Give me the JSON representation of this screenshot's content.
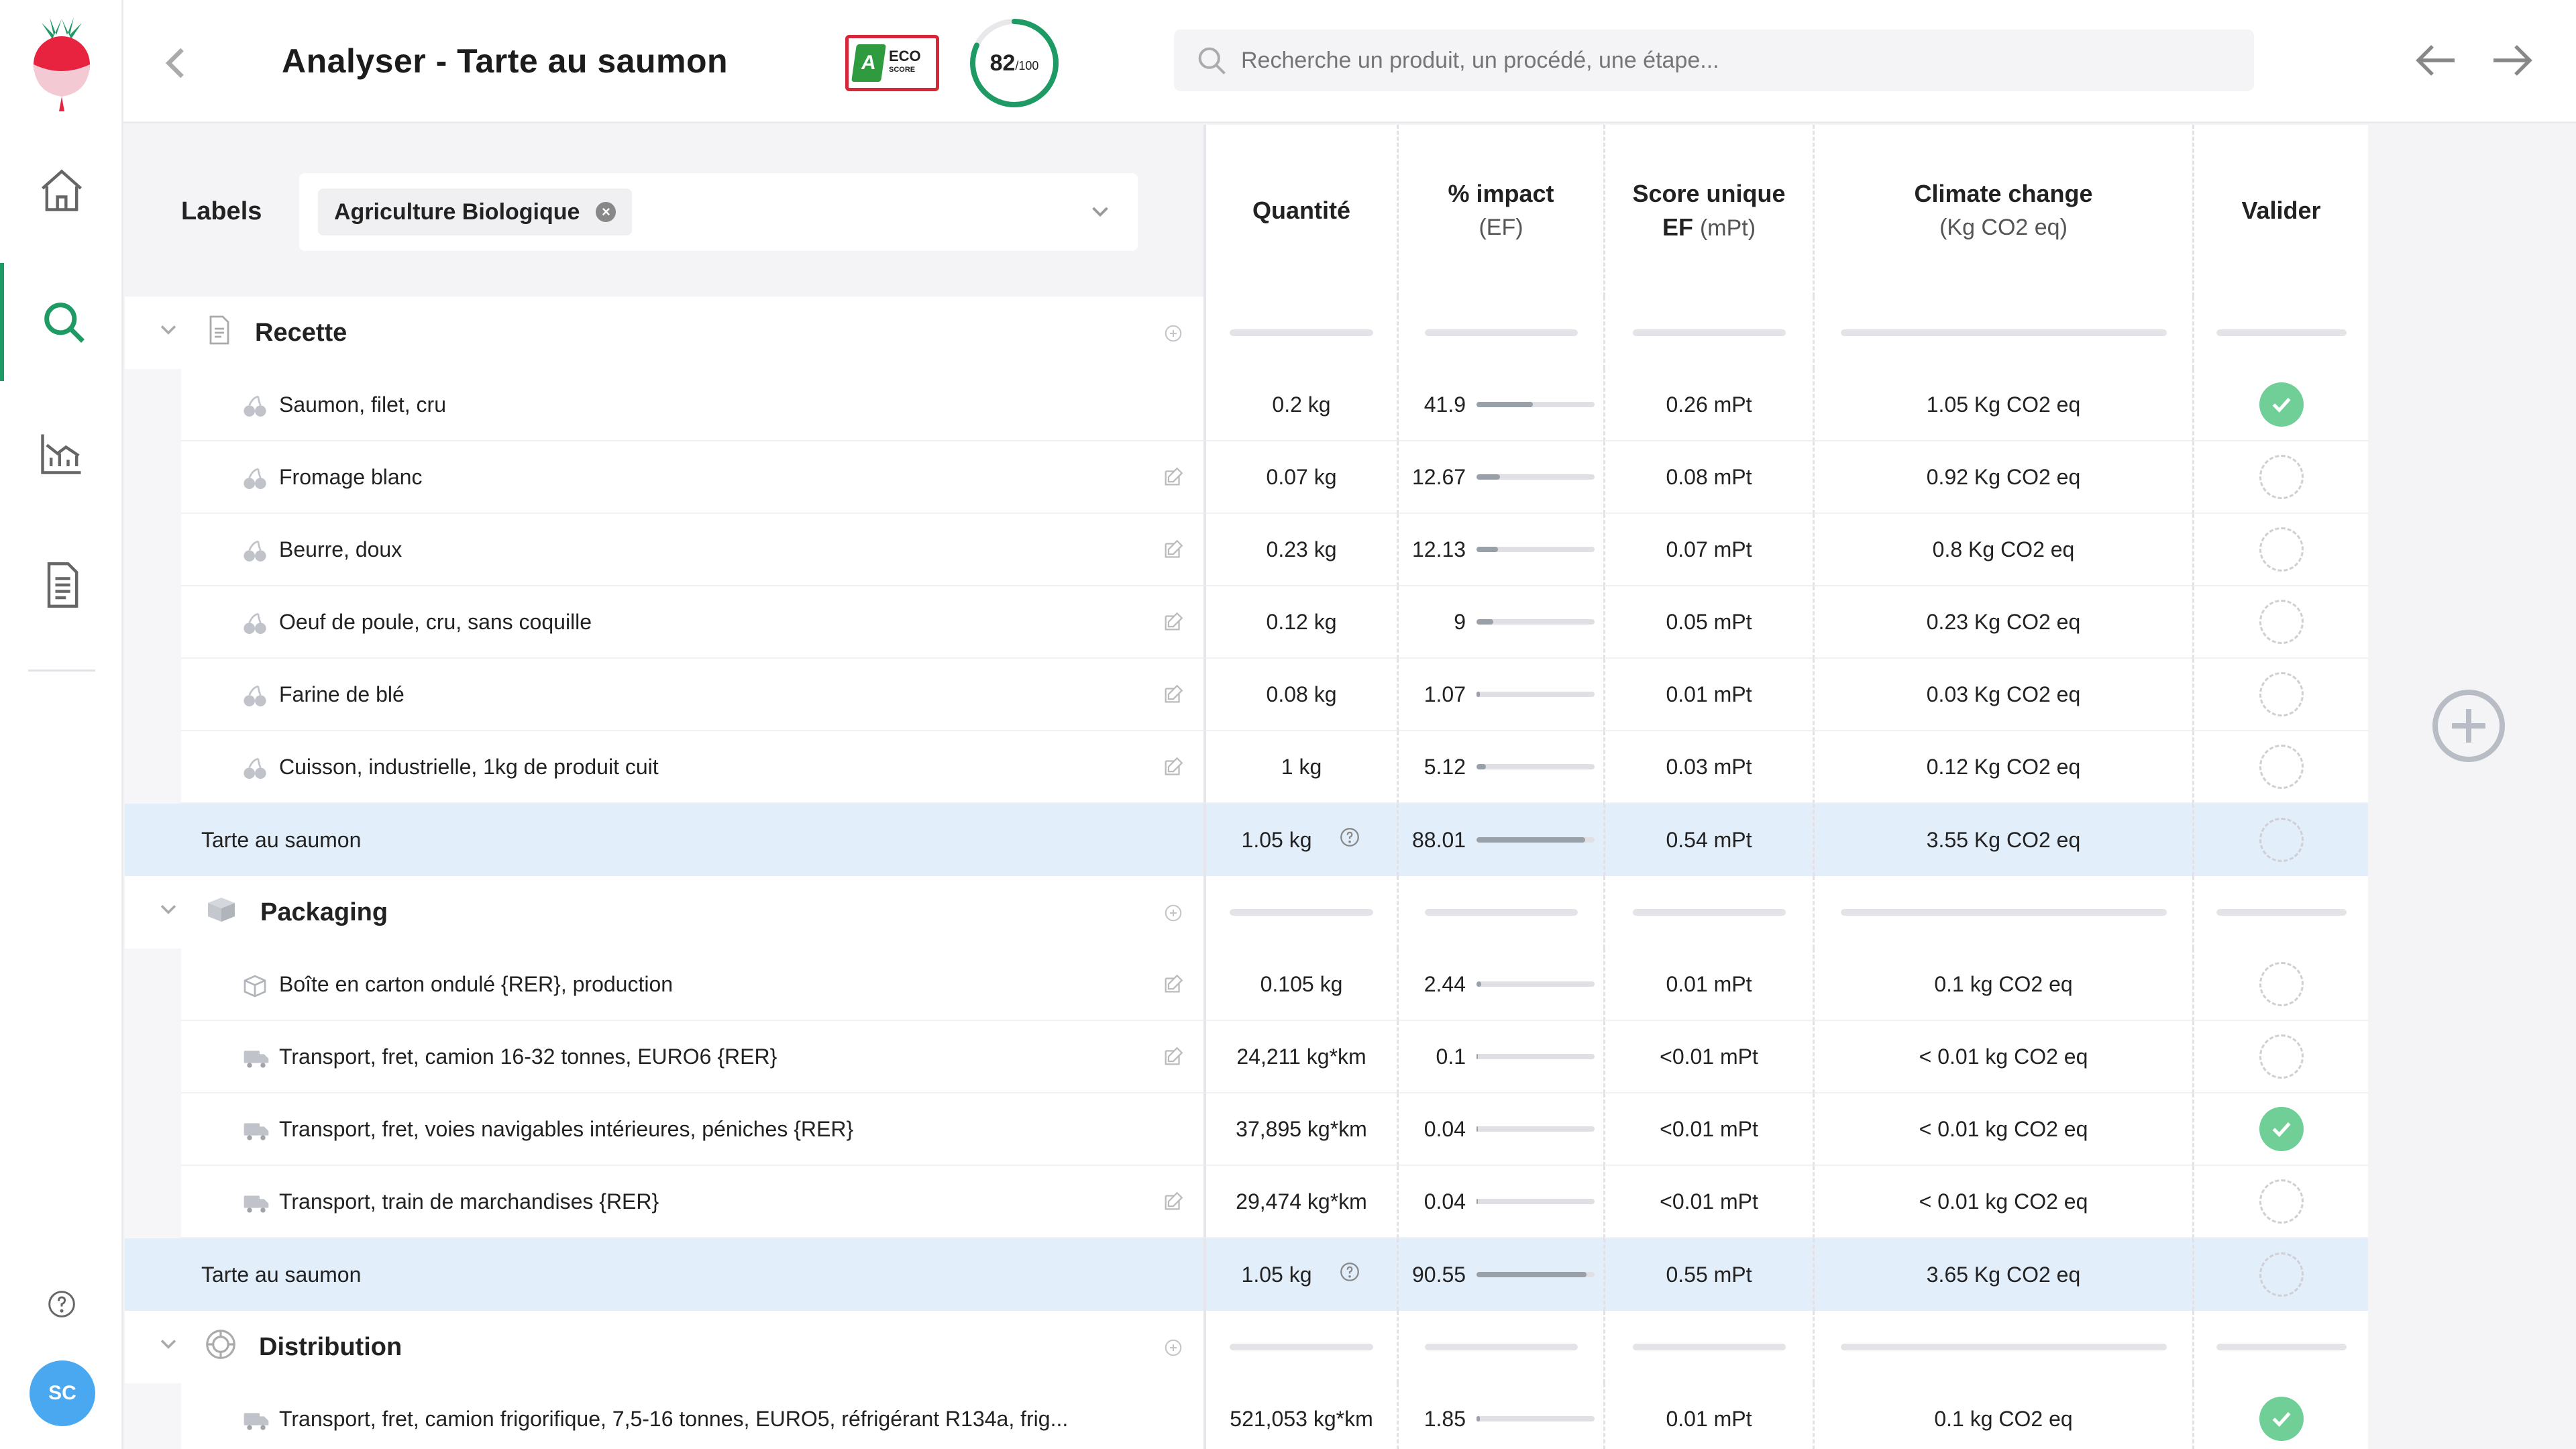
{
  "header": {
    "title": "Analyser - Tarte au saumon",
    "eco_letter": "A",
    "eco_text": "ECO",
    "eco_sub": "SCORE",
    "score_value": "82",
    "score_max": "/100",
    "score_fraction": 0.82,
    "search_placeholder": "Recherche un produit, un procédé, une étape..."
  },
  "sidebar": {
    "avatar": "SC"
  },
  "filters": {
    "labels_title": "Labels",
    "chip": "Agriculture Biologique"
  },
  "columns": {
    "qty": "Quantité",
    "impact": "% impact",
    "impact_sub": "(EF)",
    "ef": "Score unique",
    "ef_bold": "EF",
    "ef_sub": "(mPt)",
    "cc": "Climate change",
    "cc_sub": "(Kg CO2 eq)",
    "valid": "Valider"
  },
  "sections": [
    {
      "label": "Recette",
      "icon": "document-icon",
      "items": [
        {
          "name": "Saumon, filet, cru",
          "qty": "0.2 kg",
          "impact": "41.9",
          "pct": 0.48,
          "ef": "0.26 mPt",
          "cc": "1.05 Kg CO2 eq",
          "valid": true,
          "edit": false,
          "icon": "ingredient-icon"
        },
        {
          "name": "Fromage blanc",
          "qty": "0.07 kg",
          "impact": "12.67",
          "pct": 0.2,
          "ef": "0.08 mPt",
          "cc": "0.92 Kg CO2 eq",
          "valid": false,
          "edit": true,
          "icon": "ingredient-icon"
        },
        {
          "name": "Beurre, doux",
          "qty": "0.23 kg",
          "impact": "12.13",
          "pct": 0.18,
          "ef": "0.07 mPt",
          "cc": "0.8 Kg CO2 eq",
          "valid": false,
          "edit": true,
          "icon": "ingredient-icon"
        },
        {
          "name": "Oeuf de poule, cru, sans coquille",
          "qty": "0.12 kg",
          "impact": "9",
          "pct": 0.14,
          "ef": "0.05 mPt",
          "cc": "0.23 Kg CO2 eq",
          "valid": false,
          "edit": true,
          "icon": "ingredient-icon"
        },
        {
          "name": "Farine de blé",
          "qty": "0.08 kg",
          "impact": "1.07",
          "pct": 0.03,
          "ef": "0.01 mPt",
          "cc": "0.03 Kg CO2 eq",
          "valid": false,
          "edit": true,
          "icon": "ingredient-icon"
        },
        {
          "name": "Cuisson, industrielle, 1kg de produit cuit",
          "qty": "1 kg",
          "impact": "5.12",
          "pct": 0.08,
          "ef": "0.03 mPt",
          "cc": "0.12 Kg CO2 eq",
          "valid": false,
          "edit": true,
          "icon": "ingredient-icon"
        }
      ],
      "subtotal": {
        "name": "Tarte au saumon",
        "qty": "1.05 kg",
        "impact": "88.01",
        "pct": 0.92,
        "ef": "0.54 mPt",
        "cc": "3.55 Kg CO2 eq"
      }
    },
    {
      "label": "Packaging",
      "icon": "box-icon",
      "items": [
        {
          "name": "Boîte en carton ondulé {RER}, production",
          "qty": "0.105 kg",
          "impact": "2.44",
          "pct": 0.04,
          "ef": "0.01 mPt",
          "cc": "0.1 kg CO2 eq",
          "valid": false,
          "edit": true,
          "icon": "package-icon"
        },
        {
          "name": "Transport, fret, camion 16-32 tonnes, EURO6 {RER}",
          "qty": "24,211 kg*km",
          "impact": "0.1",
          "pct": 0.01,
          "ef": "<0.01 mPt",
          "cc": "< 0.01 kg CO2 eq",
          "valid": false,
          "edit": true,
          "icon": "truck-icon"
        },
        {
          "name": "Transport, fret, voies navigables intérieures, péniches {RER}",
          "qty": "37,895 kg*km",
          "impact": "0.04",
          "pct": 0.01,
          "ef": "<0.01 mPt",
          "cc": "< 0.01 kg CO2 eq",
          "valid": true,
          "edit": false,
          "icon": "truck-icon"
        },
        {
          "name": "Transport, train de marchandises {RER}",
          "qty": "29,474 kg*km",
          "impact": "0.04",
          "pct": 0.01,
          "ef": "<0.01 mPt",
          "cc": "< 0.01 kg CO2 eq",
          "valid": false,
          "edit": true,
          "icon": "truck-icon"
        }
      ],
      "subtotal": {
        "name": "Tarte au saumon",
        "qty": "1.05 kg",
        "impact": "90.55",
        "pct": 0.93,
        "ef": "0.55 mPt",
        "cc": "3.65 Kg CO2 eq"
      }
    },
    {
      "label": "Distribution",
      "icon": "distribution-icon",
      "items": [
        {
          "name": "Transport, fret, camion frigorifique, 7,5-16 tonnes, EURO5, réfrigérant R134a, frig...",
          "qty": "521,053 kg*km",
          "impact": "1.85",
          "pct": 0.03,
          "ef": "0.01 mPt",
          "cc": "0.1 kg CO2 eq",
          "valid": true,
          "edit": false,
          "icon": "truck-icon"
        }
      ]
    }
  ],
  "colors": {
    "accent": "#1e9a64",
    "check": "#6fcf97",
    "subtotal_bg": "#e3eefb",
    "eco_border": "#d6263a"
  }
}
